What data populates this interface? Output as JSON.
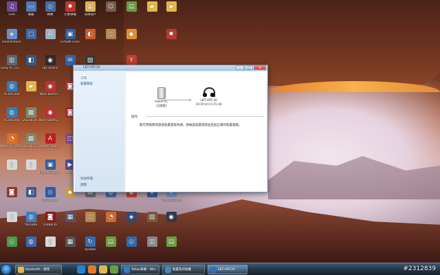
{
  "desktop_icons": [
    {
      "label": "Lala",
      "icon": "app-icon",
      "color": "#6b4a9a",
      "glyph": "♫",
      "col": 0,
      "row": 0
    },
    {
      "label": "電腦",
      "icon": "computer-icon",
      "color": "#4a7ab8",
      "glyph": "▭",
      "col": 1,
      "row": 0
    },
    {
      "label": "網路",
      "icon": "network-icon",
      "color": "#3a6fb0",
      "glyph": "◎",
      "col": 2,
      "row": 0
    },
    {
      "label": "元素爆破",
      "icon": "app-icon",
      "color": "#c0362c",
      "glyph": "✸",
      "col": 3,
      "row": 0
    },
    {
      "label": "冒險島R",
      "icon": "game-icon",
      "color": "#e3b342",
      "glyph": "▦",
      "col": 4,
      "row": 0
    },
    {
      "label": "",
      "icon": "app-icon",
      "color": "#7a5a4a",
      "glyph": "☺",
      "col": 5,
      "row": 0
    },
    {
      "label": "",
      "icon": "app-icon",
      "color": "#68a13c",
      "glyph": "▤",
      "col": 6,
      "row": 0
    },
    {
      "label": "",
      "icon": "folder-icon",
      "color": "#e1b84c",
      "glyph": "▰",
      "col": 7,
      "row": 0
    },
    {
      "label": "",
      "icon": "folder-icon",
      "color": "#e1b84c",
      "glyph": "▰",
      "col": 8,
      "row": 0
    },
    {
      "label": "Hearthstone",
      "icon": "game-icon",
      "color": "#6b8fcc",
      "glyph": "◈",
      "col": 0,
      "row": 1
    },
    {
      "label": "",
      "icon": "app-icon",
      "color": "#3b6aa8",
      "glyph": "▢",
      "col": 1,
      "row": 1
    },
    {
      "label": "",
      "icon": "recycle-bin-icon",
      "color": "#9ab0c8",
      "glyph": "♻",
      "col": 2,
      "row": 1
    },
    {
      "label": "EPSON Scan",
      "icon": "scanner-icon",
      "color": "#2e5fa6",
      "glyph": "▣",
      "col": 3,
      "row": 1
    },
    {
      "label": "",
      "icon": "app-icon",
      "color": "#d05a2c",
      "glyph": "◐",
      "col": 4,
      "row": 1
    },
    {
      "label": "",
      "icon": "app-icon",
      "color": "#b8874a",
      "glyph": "◫",
      "col": 5,
      "row": 1
    },
    {
      "label": "",
      "icon": "app-icon",
      "color": "#e0922c",
      "glyph": "◆",
      "col": 6,
      "row": 1
    },
    {
      "label": "",
      "icon": "app-icon",
      "color": "#b43a30",
      "glyph": "✹",
      "col": 8,
      "row": 1
    },
    {
      "label": "Sony PC Compa...",
      "icon": "app-icon",
      "color": "#5a6a7a",
      "glyph": "▥",
      "col": 0,
      "row": 2
    },
    {
      "label": "",
      "icon": "app-icon",
      "color": "#335a88",
      "glyph": "◧",
      "col": 1,
      "row": 2
    },
    {
      "label": "HD VDeck",
      "icon": "app-icon",
      "color": "#2c2c2c",
      "glyph": "◉",
      "col": 2,
      "row": 2
    },
    {
      "label": "",
      "icon": "app-icon",
      "color": "#2f64b0",
      "glyph": "✉",
      "col": 3,
      "row": 2
    },
    {
      "label": "",
      "icon": "app-icon",
      "color": "#3a3a3a",
      "glyph": "▧",
      "col": 4,
      "row": 2
    },
    {
      "label": "",
      "icon": "app-icon",
      "color": "#c43c2a",
      "glyph": "Y",
      "col": 6,
      "row": 2
    },
    {
      "label": "eClick.exe",
      "icon": "app-icon",
      "color": "#2d7fc0",
      "glyph": "◍",
      "col": 0,
      "row": 3
    },
    {
      "label": "",
      "icon": "folder-icon",
      "color": "#e1b84c",
      "glyph": "▰",
      "col": 1,
      "row": 3
    },
    {
      "label": "Nero Burnin...",
      "icon": "app-icon",
      "color": "#c02f2f",
      "glyph": "◉",
      "col": 2,
      "row": 3
    },
    {
      "label": "",
      "icon": "app-icon",
      "color": "#b03030",
      "glyph": "◙",
      "col": 3,
      "row": 3
    },
    {
      "label": "eClick.exe",
      "icon": "app-icon",
      "color": "#2d7fc0",
      "glyph": "◍",
      "col": 0,
      "row": 4
    },
    {
      "label": "DSC0834...",
      "icon": "image-icon",
      "color": "#7c8a6a",
      "glyph": "▩",
      "col": 1,
      "row": 4
    },
    {
      "label": "Nero StartSm...",
      "icon": "app-icon",
      "color": "#c02f2f",
      "glyph": "◉",
      "col": 2,
      "row": 4
    },
    {
      "label": "",
      "icon": "app-icon",
      "color": "#a52a2a",
      "glyph": "◙",
      "col": 3,
      "row": 4
    },
    {
      "label": "Mozilla Firefox",
      "icon": "firefox-icon",
      "color": "#e66a1c",
      "glyph": "◔",
      "col": 0,
      "row": 5
    },
    {
      "label": "DSC0835...",
      "icon": "image-icon",
      "color": "#7c8a6a",
      "glyph": "▩",
      "col": 1,
      "row": 5
    },
    {
      "label": "Adobe Reader X",
      "icon": "pdf-icon",
      "color": "#c31d1d",
      "glyph": "A",
      "col": 2,
      "row": 5
    },
    {
      "label": "",
      "icon": "app-icon",
      "color": "#8a4a8a",
      "glyph": "◫",
      "col": 3,
      "row": 5
    },
    {
      "label": "",
      "icon": "document-icon",
      "color": "#d8d8d8",
      "glyph": "▯",
      "col": 0,
      "row": 6
    },
    {
      "label": "",
      "icon": "document-icon",
      "color": "#d8d8d8",
      "glyph": "▯",
      "col": 1,
      "row": 6
    },
    {
      "label": "Epson Easy Photo Print",
      "icon": "app-icon",
      "color": "#2e5fa6",
      "glyph": "▣",
      "col": 2,
      "row": 6
    },
    {
      "label": "Media",
      "icon": "app-icon",
      "color": "#5a4a9a",
      "glyph": "▶",
      "col": 3,
      "row": 6
    },
    {
      "label": "",
      "icon": "app-icon",
      "color": "#8a3a2a",
      "glyph": "◙",
      "col": 0,
      "row": 7
    },
    {
      "label": "",
      "icon": "app-icon",
      "color": "#445a8a",
      "glyph": "◧",
      "col": 1,
      "row": 7
    },
    {
      "label": "RealPlayer",
      "icon": "app-icon",
      "color": "#2c5aa8",
      "glyph": "◎",
      "col": 2,
      "row": 7
    },
    {
      "label": "",
      "icon": "app-icon",
      "color": "#d0a040",
      "glyph": "◆",
      "col": 3,
      "row": 7
    },
    {
      "label": "",
      "icon": "app-icon",
      "color": "#6a6a6a",
      "glyph": "▤",
      "col": 4,
      "row": 7
    },
    {
      "label": "",
      "icon": "app-icon",
      "color": "#3b6aa8",
      "glyph": "◍",
      "col": 5,
      "row": 7
    },
    {
      "label": "",
      "icon": "app-icon",
      "color": "#c43c2a",
      "glyph": "◉",
      "col": 6,
      "row": 7
    },
    {
      "label": "",
      "icon": "app-icon",
      "color": "#355a9a",
      "glyph": "◈",
      "col": 7,
      "row": 7
    },
    {
      "label": "Hearthstone",
      "icon": "game-icon",
      "color": "#6b8fcc",
      "glyph": "◈",
      "col": 8,
      "row": 7
    },
    {
      "label": "",
      "icon": "document-icon",
      "color": "#d8d8d8",
      "glyph": "▯",
      "col": 0,
      "row": 8
    },
    {
      "label": "YouTube",
      "icon": "globe-icon",
      "color": "#3a7fc8",
      "glyph": "◍",
      "col": 1,
      "row": 8
    },
    {
      "label": "Diablo III",
      "icon": "game-icon",
      "color": "#8a1a1a",
      "glyph": "◙",
      "col": 2,
      "row": 8
    },
    {
      "label": "",
      "icon": "app-icon",
      "color": "#556",
      "glyph": "▦",
      "col": 3,
      "row": 8
    },
    {
      "label": "",
      "icon": "app-icon",
      "color": "#b8874a",
      "glyph": "◫",
      "col": 4,
      "row": 8
    },
    {
      "label": "",
      "icon": "app-icon",
      "color": "#d06a2a",
      "glyph": "◔",
      "col": 5,
      "row": 8
    },
    {
      "label": "",
      "icon": "app-icon",
      "color": "#2c4a7a",
      "glyph": "◈",
      "col": 6,
      "row": 8
    },
    {
      "label": "",
      "icon": "app-icon",
      "color": "#7a5a3a",
      "glyph": "▧",
      "col": 7,
      "row": 8
    },
    {
      "label": "",
      "icon": "app-icon",
      "color": "#2f3a4a",
      "glyph": "◉",
      "col": 8,
      "row": 8
    },
    {
      "label": "",
      "icon": "app-icon",
      "color": "#4a9a4a",
      "glyph": "◎",
      "col": 0,
      "row": 9
    },
    {
      "label": "",
      "icon": "app-icon",
      "color": "#3a6ab0",
      "glyph": "◍",
      "col": 1,
      "row": 9
    },
    {
      "label": "",
      "icon": "app-icon",
      "color": "#d8d8d8",
      "glyph": "▯",
      "col": 2,
      "row": 9
    },
    {
      "label": "",
      "icon": "app-icon",
      "color": "#555",
      "glyph": "▦",
      "col": 3,
      "row": 9
    },
    {
      "label": "Update",
      "icon": "app-icon",
      "color": "#3a6ab0",
      "glyph": "↻",
      "col": 4,
      "row": 9
    },
    {
      "label": "",
      "icon": "app-icon",
      "color": "#68a13c",
      "glyph": "▤",
      "col": 5,
      "row": 9
    },
    {
      "label": "",
      "icon": "app-icon",
      "color": "#2c6ab0",
      "glyph": "◎",
      "col": 6,
      "row": 9
    },
    {
      "label": "",
      "icon": "app-icon",
      "color": "#888",
      "glyph": "▥",
      "col": 7,
      "row": 9
    },
    {
      "label": "",
      "icon": "app-icon",
      "color": "#68a13c",
      "glyph": "▤",
      "col": 8,
      "row": 9
    }
  ],
  "dialog": {
    "title": "LBT-HPC30",
    "side": {
      "section_title": "工作",
      "link": "裝置階段",
      "see_also": "另請參閱",
      "help_link": "說明"
    },
    "device_pc": {
      "name": "USER-PC",
      "sub": "(此電腦)"
    },
    "device_headset": {
      "name": "LBT-HPC30",
      "sub": "00:09:dd:41:55:d8"
    },
    "ops_title": "操作",
    "ops_message": "無可用服務或連接裝置連接失敗。請檢查裝置連接並且與正確的裝置連線。",
    "buttons": {
      "minimize": "–",
      "maximize": "□",
      "close": "✕"
    }
  },
  "taskbar": {
    "items": [
      {
        "label": "bluetooth - 搜尋",
        "icon": "folder-icon",
        "color": "#e1b84c",
        "active": false
      },
      {
        "label": "Yahoo奇摩 - Win...",
        "icon": "ie-icon",
        "color": "#2a7fd0",
        "active": false
      },
      {
        "label": "裝置及印表機",
        "icon": "devices-icon",
        "color": "#4a8ab8",
        "active": false
      },
      {
        "label": "LBT-HPC30",
        "icon": "bluetooth-icon",
        "color": "#2f6fc0",
        "active": true
      }
    ],
    "pinned": [
      {
        "icon": "ie-icon",
        "color": "#2a7fd0"
      },
      {
        "icon": "media-player-icon",
        "color": "#e07a2a"
      },
      {
        "icon": "folder-icon",
        "color": "#e1b84c"
      },
      {
        "icon": "app-icon",
        "color": "#68a13c"
      }
    ]
  },
  "watermark": "#2312839"
}
